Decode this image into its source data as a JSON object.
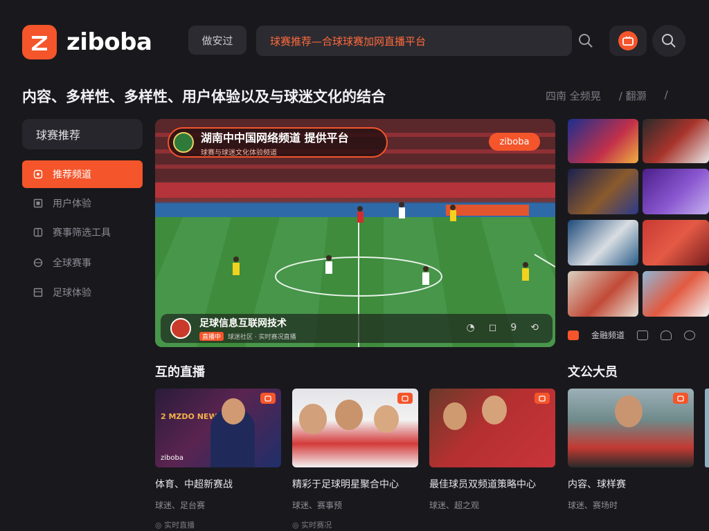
{
  "app": {
    "brand": "ziboba"
  },
  "header": {
    "nav_button": "做安过",
    "search_text": "球赛推荐—合球球赛加网直播平台",
    "page_title": "内容、多样性、多样性、用户体验以及与球迷文化的结合",
    "links": [
      "四南 全频晃",
      "/ 翻灏",
      "/"
    ]
  },
  "sidebar": {
    "heading": "球赛推荐",
    "items": [
      {
        "label": "推荐频道",
        "icon": "home-icon",
        "active": true
      },
      {
        "label": "用户体验",
        "icon": "square-icon",
        "active": false
      },
      {
        "label": "赛事筛选工具",
        "icon": "grid-icon",
        "active": false
      },
      {
        "label": "全球赛事",
        "icon": "globe-icon",
        "active": false
      },
      {
        "label": "足球体验",
        "icon": "ball-icon",
        "active": false
      }
    ]
  },
  "hero": {
    "title": "湖南中中国网络频道  提供平台",
    "subtitle": "球赛与球迷文化体验频道",
    "brand_pill": "ziboba",
    "bottom_title": "足球信息互联网技术",
    "bottom_tag": "直播中",
    "bottom_meta": "球迷社区 · 实时赛况直播",
    "controls": [
      "◔",
      "◻",
      "9",
      "⟲"
    ]
  },
  "right_panel": {
    "filter_label": "金融频道",
    "filters": [
      "square-icon",
      "home-icon",
      "chat-icon"
    ],
    "section_title": "文公大员"
  },
  "live_section": {
    "title": "互的直播"
  },
  "cards": [
    {
      "title": "体育、中超新赛战",
      "meta": "球迷、足台赛",
      "foot": "◎ 实时直播",
      "brand": "ziboba",
      "img_caption": "2 MZDO NEWS"
    },
    {
      "title": "精彩于足球明星聚合中心",
      "meta": "球迷、赛事预",
      "foot": "◎ 实时赛况"
    },
    {
      "title": "最佳球员双频道策略中心",
      "meta": "球迷、超之观",
      "foot": ""
    },
    {
      "title": "内容、球样赛",
      "meta": "球迷、赛场时",
      "foot": ""
    }
  ],
  "colors": {
    "accent": "#f4552b",
    "bg": "#19191d",
    "panel": "#2b2b31"
  }
}
